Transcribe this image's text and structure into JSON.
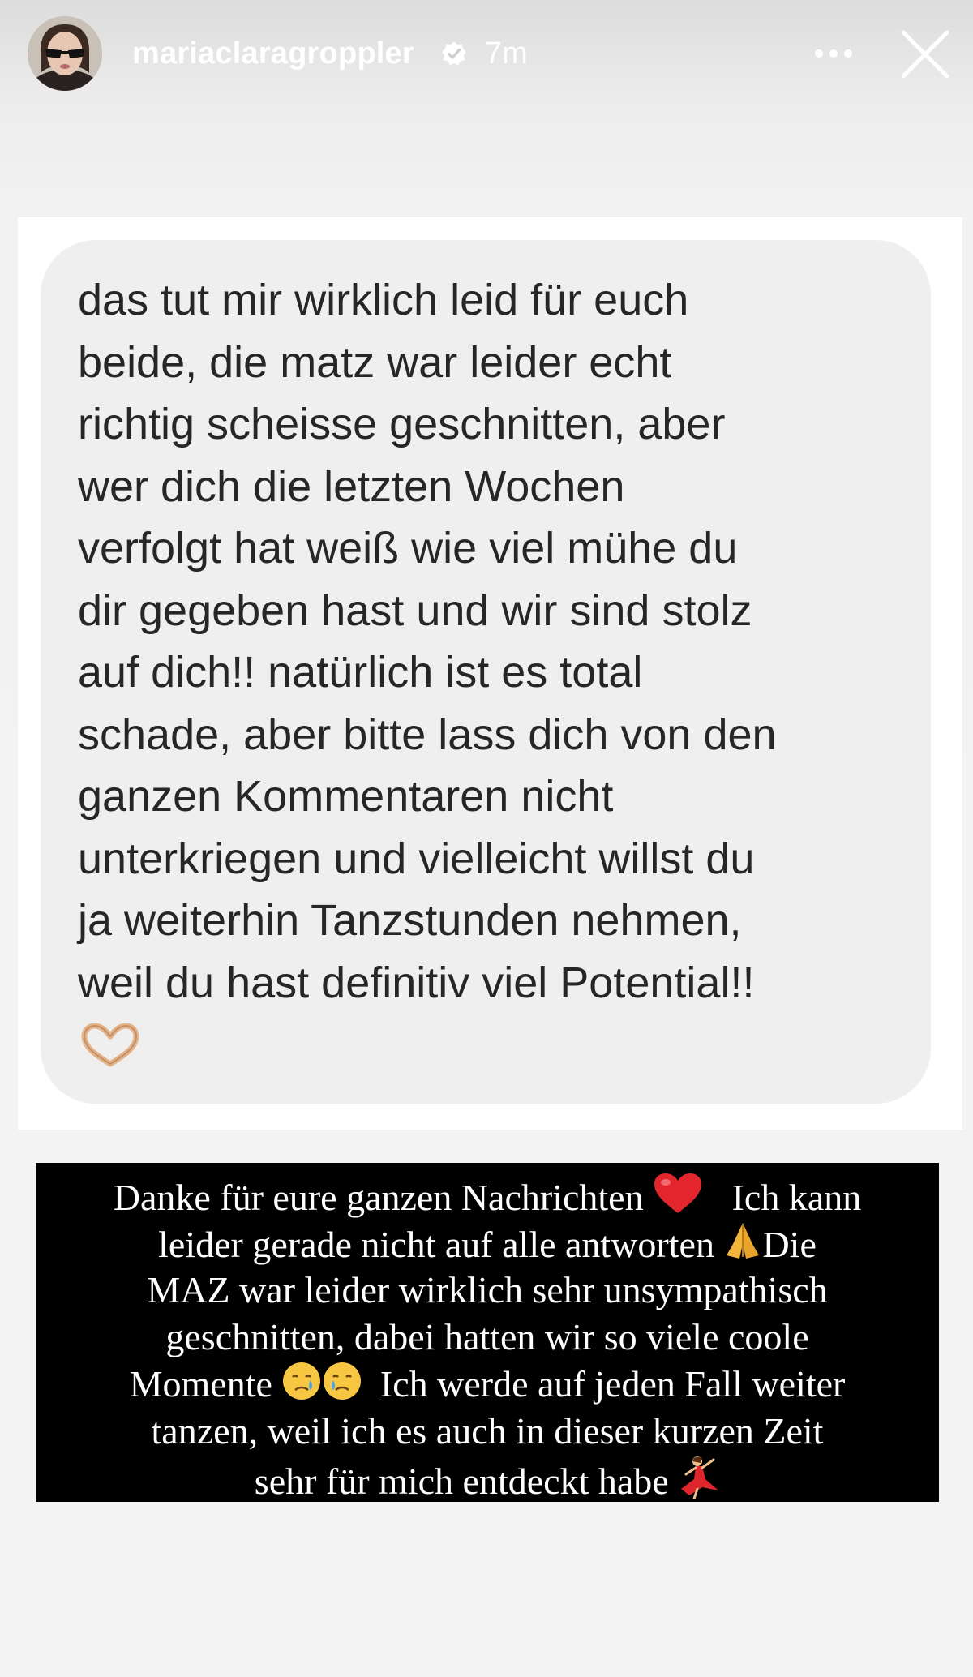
{
  "header": {
    "username": "mariaclaragroppler",
    "time": "7m",
    "icons": {
      "avatar": "profile-photo",
      "verified": "verified-badge-icon",
      "more": "more-options-icon",
      "close": "close-icon"
    }
  },
  "dm": {
    "lines": [
      "das tut mir wirklich leid für euch",
      "beide, die matz war leider echt",
      "richtig scheisse geschnitten, aber",
      "wer dich die letzten Wochen",
      "verfolgt hat weiß wie viel mühe du",
      "dir gegeben hast und wir sind stolz",
      "auf dich!! natürlich ist es total",
      "schade, aber bitte lass dich von den",
      "ganzen Kommentaren nicht",
      "unterkriegen und vielleicht willst du",
      "ja weiterhin Tanzstunden nehmen,",
      "weil du hast definitiv viel Potential!!"
    ],
    "emoji": "heart-hands"
  },
  "caption": {
    "line1_a": "Danke für eure ganzen Nachrichten",
    "line1_b": "Ich kann",
    "line2_a": "leider gerade nicht auf alle antworten",
    "line2_b": "Die",
    "line3": "MAZ war leider wirklich sehr unsympathisch",
    "line4": "geschnitten, dabei hatten wir so viele coole",
    "line5_a": "Momente",
    "line5_b": "Ich werde auf jeden Fall weiter",
    "line6": "tanzen, weil ich es auch in dieser kurzen Zeit",
    "line7": "sehr für mich entdeckt habe",
    "emojis": [
      "red-heart",
      "folded-hands",
      "crying-face",
      "crying-face",
      "dancer"
    ]
  },
  "colors": {
    "dm_bubble": "#efefef",
    "dm_text": "#262626",
    "caption_bg": "#000000",
    "caption_text": "#ffffff"
  }
}
